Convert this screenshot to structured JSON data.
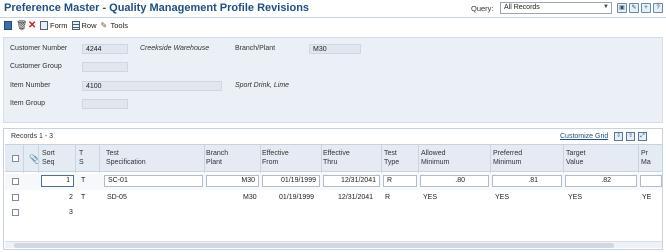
{
  "window": {
    "title": "Preference Master - Quality Management Profile Revisions",
    "query_label": "Query:",
    "query_value": "All Records"
  },
  "toolbar": {
    "form_label": "Form",
    "row_label": "Row",
    "tools_label": "Tools"
  },
  "header": {
    "customer_number_label": "Customer Number",
    "customer_number_value": "4244",
    "customer_name": "Creekside Warehouse",
    "branch_plant_label": "Branch/Plant",
    "branch_plant_value": "M30",
    "customer_group_label": "Customer Group",
    "customer_group_value": "",
    "item_number_label": "Item Number",
    "item_number_value": "4100",
    "item_description": "Sport Drink, Lime",
    "item_group_label": "Item Group",
    "item_group_value": ""
  },
  "grid": {
    "records_label": "Records 1 - 3",
    "customize_label": "Customize Grid",
    "columns": [
      "Sort\nSeq",
      "T\nS",
      "Test\nSpecification",
      "Branch\nPlant",
      "Effective\nFrom",
      "Effective\nThru",
      "Test\nType",
      "Allowed\nMinimum",
      "Preferred\nMinimum",
      "Target\nValue",
      "Pr\nMa"
    ],
    "rows": [
      {
        "seq": "1",
        "ts": "T",
        "spec": "SC-01",
        "branch": "M30",
        "from": "01/19/1999",
        "thru": "12/31/2041",
        "type": "R",
        "allowed": ".80",
        "preferred": ".81",
        "target": ".82",
        "pref_max": ""
      },
      {
        "seq": "2",
        "ts": "T",
        "spec": "SD-05",
        "branch": "M30",
        "from": "01/19/1999",
        "thru": "12/31/2041",
        "type": "R",
        "allowed": "YES",
        "preferred": "YES",
        "target": "YES",
        "pref_max": "YE"
      },
      {
        "seq": "3",
        "ts": "",
        "spec": "",
        "branch": "",
        "from": "",
        "thru": "",
        "type": "",
        "allowed": "",
        "preferred": "",
        "target": "",
        "pref_max": ""
      }
    ]
  }
}
